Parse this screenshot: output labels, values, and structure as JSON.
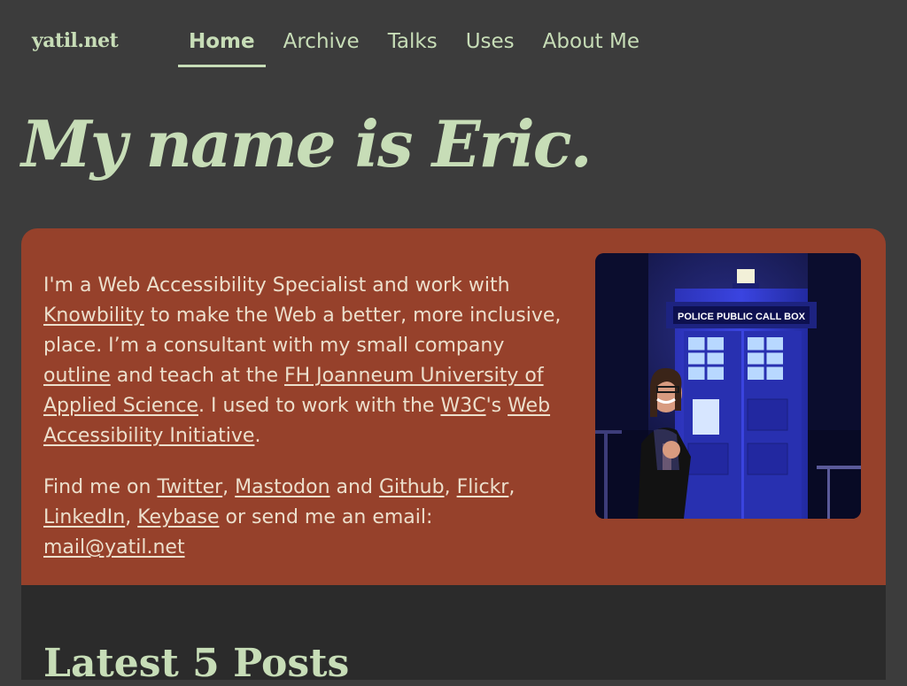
{
  "header": {
    "site_name": "yatil.net",
    "nav": [
      {
        "label": "Home",
        "active": true
      },
      {
        "label": "Archive",
        "active": false
      },
      {
        "label": "Talks",
        "active": false
      },
      {
        "label": "Uses",
        "active": false
      },
      {
        "label": "About Me",
        "active": false
      }
    ]
  },
  "hero": {
    "title": "My name is Eric."
  },
  "intro": {
    "p1": {
      "t1": "I'm a Web Accessibility Specialist and work with ",
      "link_knowbility": "Knowbility",
      "t2": " to make the Web a better, more inclusive, place. I’m a consultant with my small company ",
      "link_outline": "outline",
      "t3": " and teach at the ",
      "link_fh": "FH Joanneum University of Applied Science",
      "t4": ". I used to work with the ",
      "link_w3c": "W3C",
      "t5": "'s ",
      "link_wai": "Web Accessibility Initiative",
      "t6": "."
    },
    "p2": {
      "t1": "Find me on ",
      "link_twitter": "Twitter",
      "sep1": ", ",
      "link_mastodon": "Mastodon",
      "t2": " and ",
      "link_github": "Github",
      "sep2": ", ",
      "link_flickr": "Flickr",
      "sep3": ", ",
      "link_linkedin": "LinkedIn",
      "sep4": ", ",
      "link_keybase": "Keybase",
      "t3": " or send me an email: ",
      "link_email": "mail@yatil.net"
    },
    "photo": {
      "sign_text": "POLICE PUBLIC CALL BOX"
    }
  },
  "posts": {
    "heading": "Latest 5 Posts"
  },
  "colors": {
    "page_bg": "#3c3c3c",
    "accent_green": "#c7ddb7",
    "card_bg": "#96412b",
    "card_text": "#ecdfcc",
    "posts_bg": "#2b2b2b"
  }
}
